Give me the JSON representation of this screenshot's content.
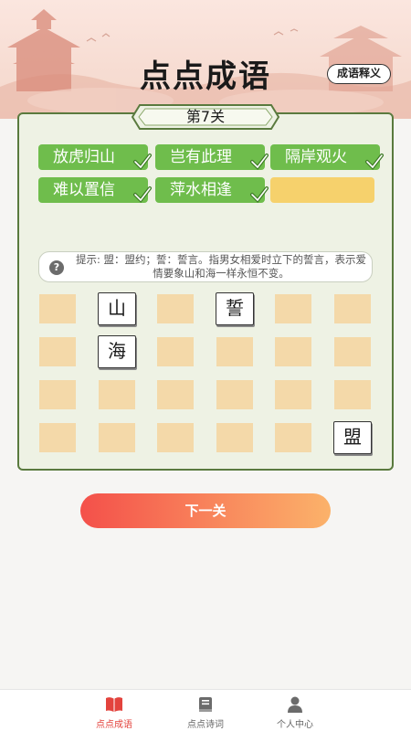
{
  "header": {
    "title": "点点成语",
    "explain_button": "成语释义"
  },
  "level": {
    "label": "第7关"
  },
  "solved_idioms": [
    {
      "text": "放虎归山",
      "status": "solved"
    },
    {
      "text": "岂有此理",
      "status": "solved"
    },
    {
      "text": "隔岸观火",
      "status": "solved"
    },
    {
      "text": "难以置信",
      "status": "solved"
    },
    {
      "text": "萍水相逢",
      "status": "solved"
    },
    {
      "text": "",
      "status": "empty"
    }
  ],
  "hint": {
    "icon": "question-icon",
    "icon_glyph": "?",
    "text": "提示: 盟：盟约；誓：誓言。指男女相爱时立下的誓言，表示爱情要象山和海一样永恒不变。"
  },
  "grid": {
    "tiles": [
      {
        "char": "山",
        "row": 1,
        "col": 2
      },
      {
        "char": "誓",
        "row": 1,
        "col": 4
      },
      {
        "char": "海",
        "row": 2,
        "col": 2
      },
      {
        "char": "盟",
        "row": 4,
        "col": 6
      }
    ]
  },
  "next_button": "下一关",
  "tabbar": {
    "items": [
      {
        "label": "点点成语",
        "icon": "book-icon",
        "active": true
      },
      {
        "label": "点点诗词",
        "icon": "poetry-book-icon",
        "active": false
      },
      {
        "label": "个人中心",
        "icon": "user-icon",
        "active": false
      }
    ]
  },
  "colors": {
    "accent_green": "#6fbd4c",
    "empty_slot": "#f6d16c",
    "grid_cell": "#f4d9a9",
    "panel_border": "#5a7a3e",
    "tab_active": "#e3433d"
  }
}
